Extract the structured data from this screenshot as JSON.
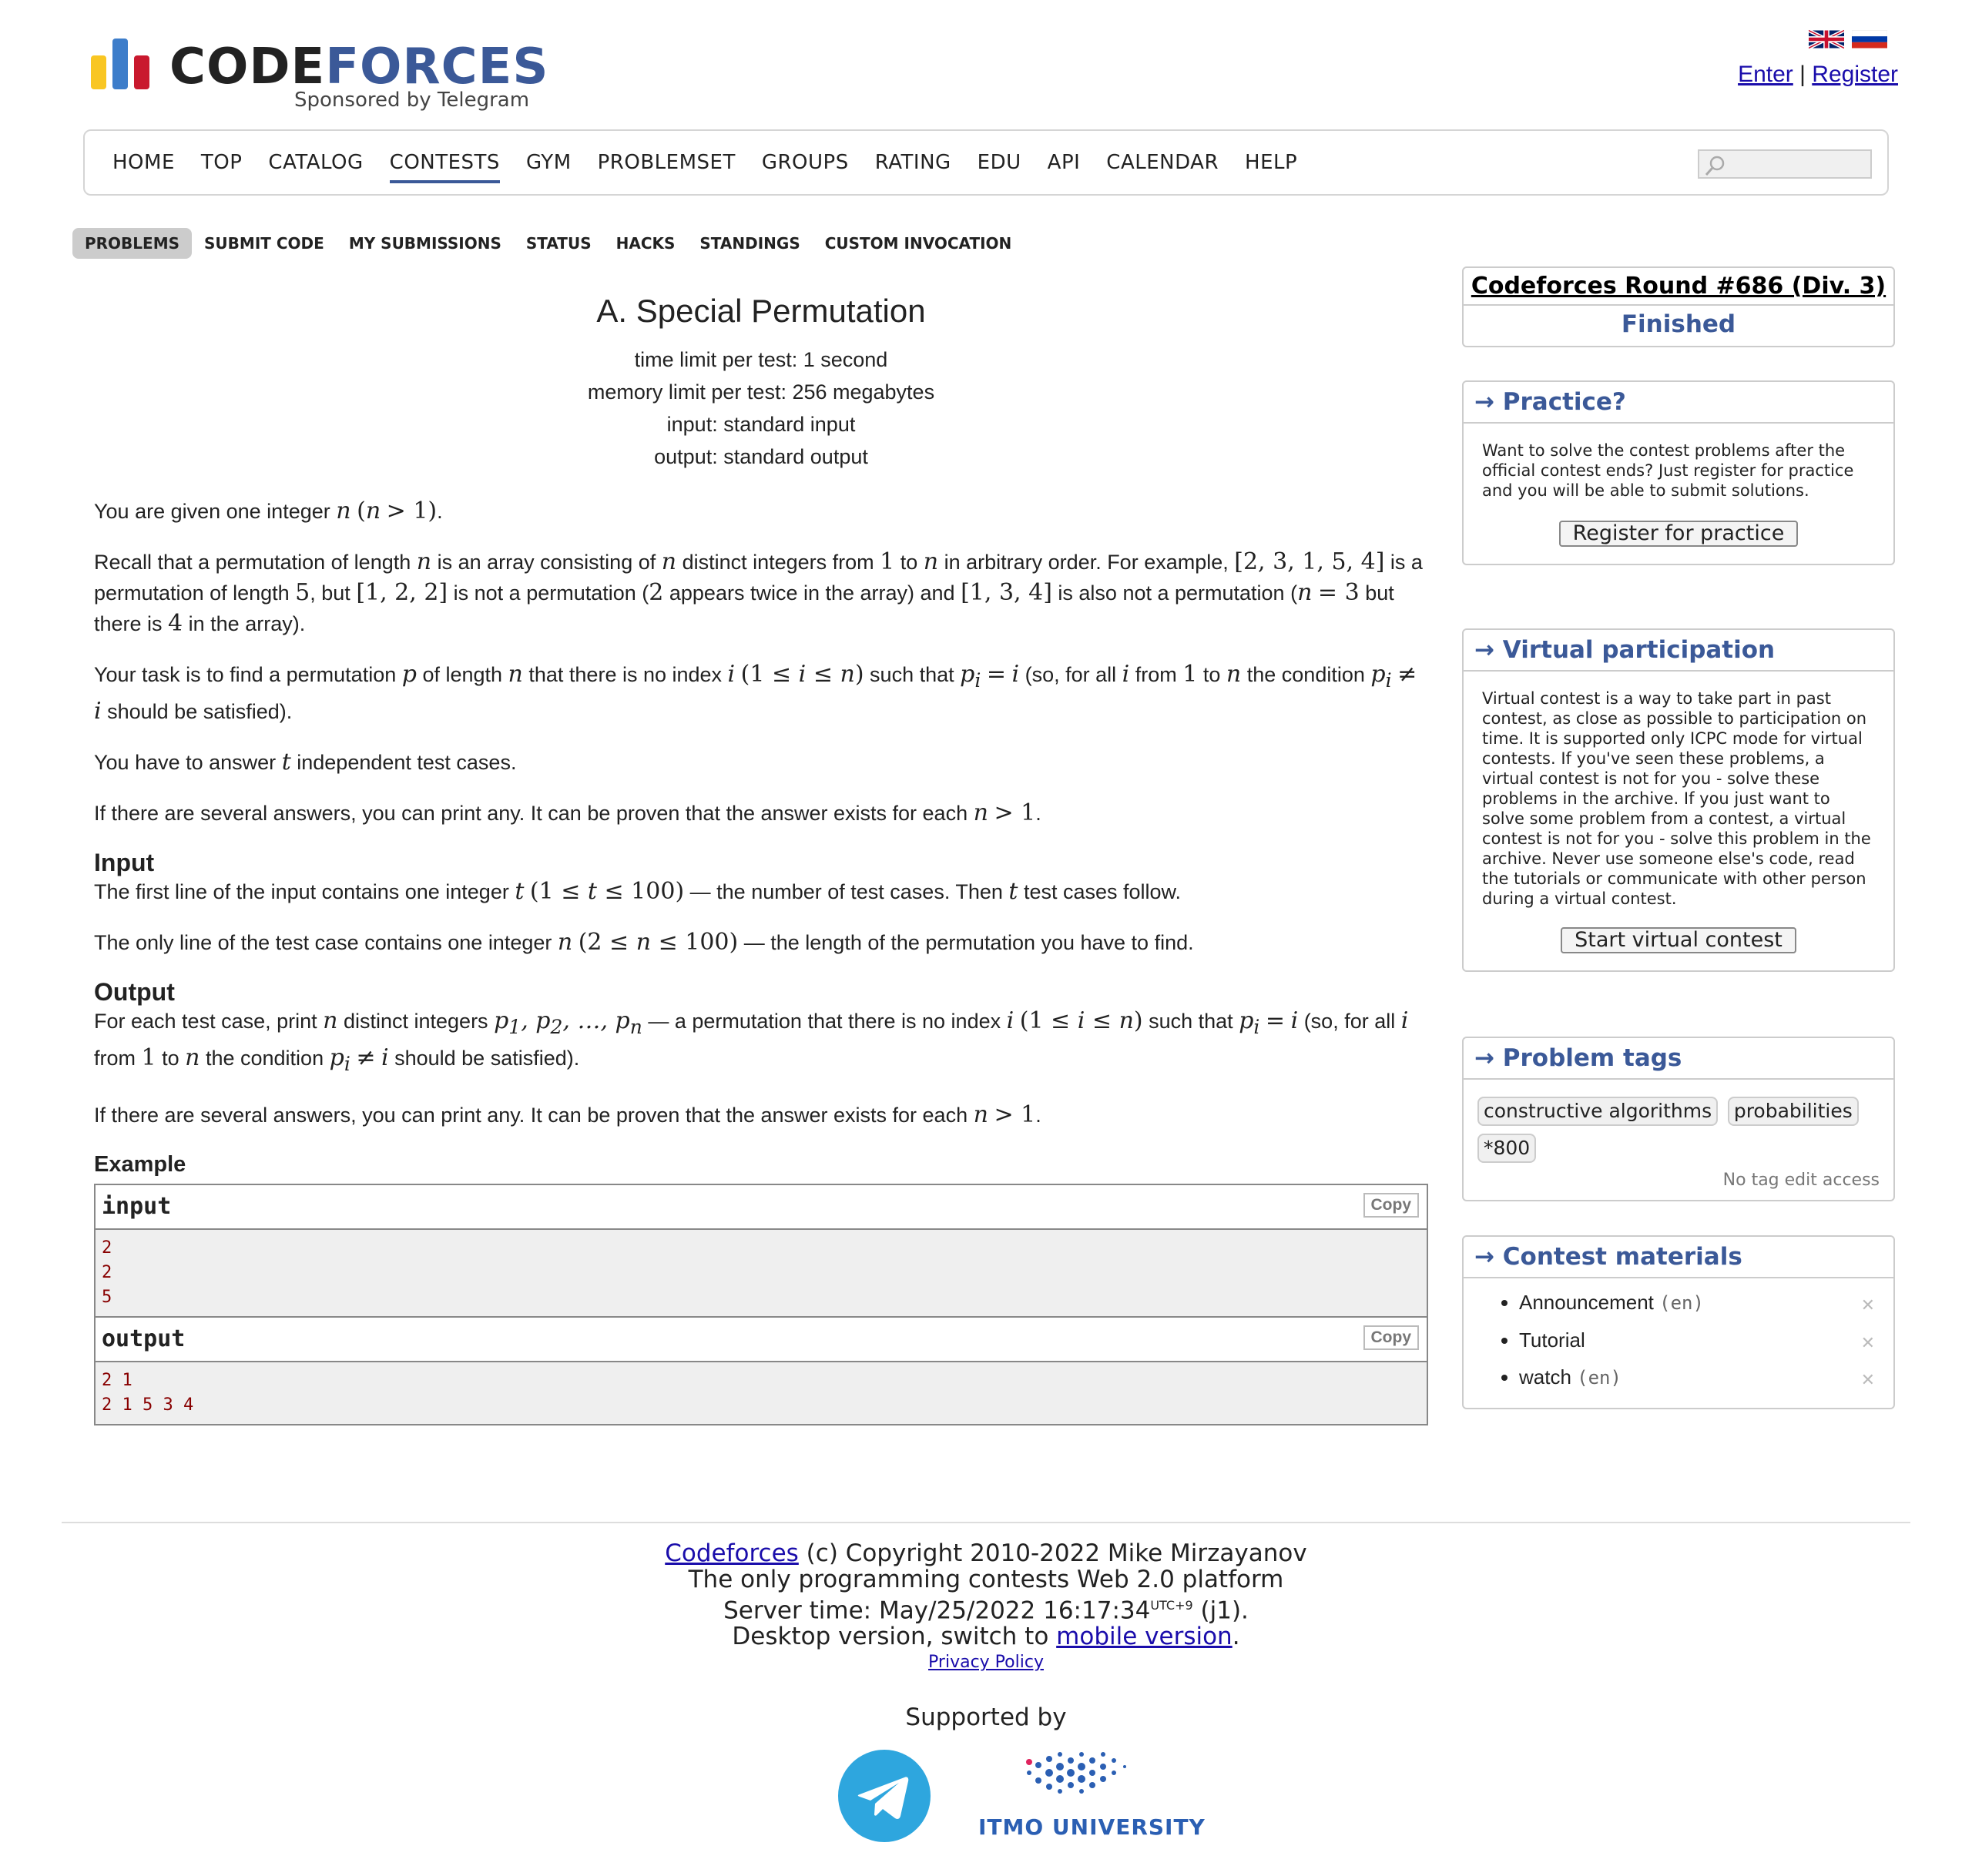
{
  "header": {
    "logo_code": "CODE",
    "logo_forces": "FORCES",
    "logo_sub": "Sponsored by Telegram",
    "enter": "Enter",
    "separator": "|",
    "register": "Register",
    "flags": [
      "uk-flag-icon",
      "ru-flag-icon"
    ]
  },
  "nav": {
    "items": [
      "HOME",
      "TOP",
      "CATALOG",
      "CONTESTS",
      "GYM",
      "PROBLEMSET",
      "GROUPS",
      "RATING",
      "EDU",
      "API",
      "CALENDAR",
      "HELP"
    ],
    "active": "CONTESTS"
  },
  "submenu": {
    "items": [
      "PROBLEMS",
      "SUBMIT CODE",
      "MY SUBMISSIONS",
      "STATUS",
      "HACKS",
      "STANDINGS",
      "CUSTOM INVOCATION"
    ],
    "active": "PROBLEMS"
  },
  "problem": {
    "title": "A. Special Permutation",
    "time_limit": "time limit per test: 1 second",
    "memory_limit": "memory limit per test: 256 megabytes",
    "input": "input: standard input",
    "output": "output: standard output",
    "input_heading": "Input",
    "output_heading": "Output",
    "example_heading": "Example"
  },
  "sample": {
    "input_label": "input",
    "output_label": "output",
    "copy_label": "Copy",
    "input_lines": [
      "2",
      "2",
      "5"
    ],
    "output_lines": [
      "2 1",
      "2 1 5 3 4"
    ]
  },
  "sidebar": {
    "contest_name": "Codeforces Round #686 (Div. 3)",
    "contest_status": "Finished",
    "practice_title": "→ Practice?",
    "practice_text": "Want to solve the contest problems after the official contest ends? Just register for practice and you will be able to submit solutions.",
    "practice_button": "Register for practice",
    "virtual_title": "→ Virtual participation",
    "virtual_text": "Virtual contest is a way to take part in past contest, as close as possible to participation on time. It is supported only ICPC mode for virtual contests. If you've seen these problems, a virtual contest is not for you - solve these problems in the archive. If you just want to solve some problem from a contest, a virtual contest is not for you - solve this problem in the archive. Never use someone else's code, read the tutorials or communicate with other person during a virtual contest.",
    "virtual_button": "Start virtual contest",
    "tags_title": "→ Problem tags",
    "tags": [
      "constructive algorithms",
      "probabilities",
      "*800"
    ],
    "no_tag_access": "No tag edit access",
    "materials_title": "→ Contest materials",
    "materials": [
      {
        "name": "Announcement",
        "lang": "(en)"
      },
      {
        "name": "Tutorial",
        "lang": ""
      },
      {
        "name": "watch",
        "lang": "(en)"
      }
    ]
  },
  "footer": {
    "codeforces_link": "Codeforces",
    "copyright": " (c) Copyright 2010-2022 Mike Mirzayanov",
    "tagline": "The only programming contests Web 2.0 platform",
    "server_time_prefix": "Server time: May/25/2022 16:17:34",
    "utc": "UTC+9",
    "server_suffix": " (j1).",
    "desktop_prefix": "Desktop version, switch to ",
    "mobile_link": "mobile version",
    "desktop_suffix": ".",
    "privacy": "Privacy Policy",
    "supported_by": "Supported by",
    "itmo": "ITMO UNIVERSITY"
  },
  "colors": {
    "brand_blue": "#3b5998",
    "telegram": "#2ea6de",
    "itmo": "#2b5fb3"
  }
}
